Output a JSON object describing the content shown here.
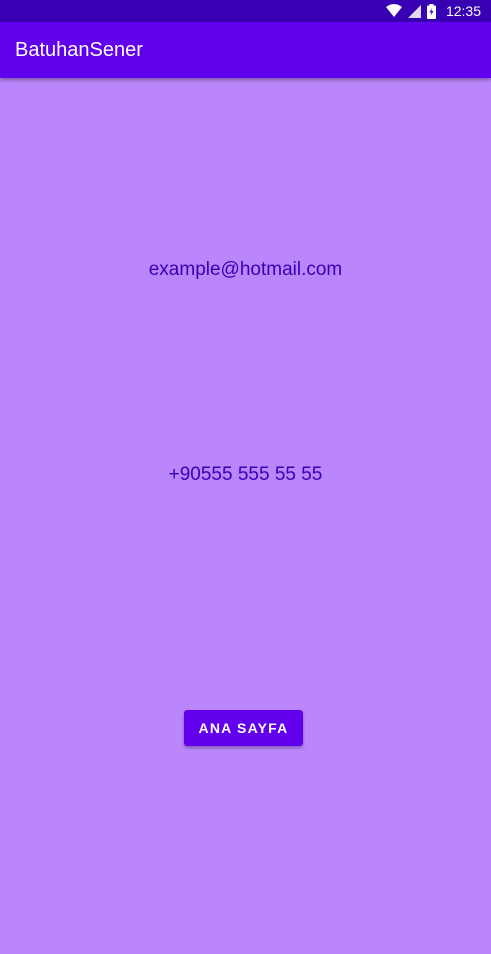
{
  "status_bar": {
    "time": "12:35",
    "icons": [
      "wifi-icon",
      "signal-icon",
      "battery-icon"
    ]
  },
  "app_bar": {
    "title": "BatuhanSener"
  },
  "content": {
    "email": "example@hotmail.com",
    "phone": "+90555 555 55 55"
  },
  "button": {
    "home_label": "ANA SAYFA"
  },
  "colors": {
    "background": "#bb86fc",
    "primary": "#6200ee",
    "primary_dark": "#3700b3"
  }
}
